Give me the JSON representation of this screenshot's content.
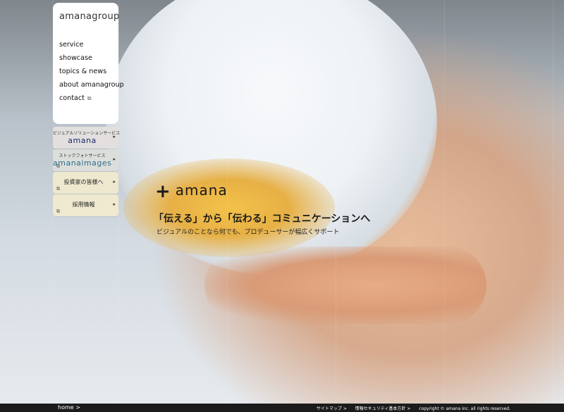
{
  "menu": {
    "logo": "amanagroup",
    "items": [
      {
        "label": "service",
        "external": false
      },
      {
        "label": "showcase",
        "external": false
      },
      {
        "label": "topics & news",
        "external": false
      },
      {
        "label": "about amanagroup",
        "external": false
      },
      {
        "label": "contact",
        "external": true,
        "ext_icon": "⧉"
      }
    ]
  },
  "subnav": {
    "amana": {
      "caption": "ビジュアルソリューションサービス",
      "brand": "amana",
      "arrow": "▸"
    },
    "images": {
      "caption": "ストックフォトサービス",
      "brand": "amanaimages",
      "arrow": "▸",
      "ext_icon": "⧉"
    },
    "investors": {
      "label": "投資家の皆様へ",
      "arrow": "▸",
      "ext_icon": "⧉"
    },
    "recruit": {
      "label": "採用情報",
      "arrow": "▸",
      "ext_icon": "⧉"
    }
  },
  "hero": {
    "mark_plus": "+",
    "mark_text": "amana",
    "tagline": "「伝える」から「伝わる」コミュニケーションへ",
    "subline": "ビジュアルのことなら何でも、プロデューサーが幅広くサポート"
  },
  "footer": {
    "home": "home >",
    "sitemap": "サイトマップ >",
    "security": "情報セキュリティ基本方針 >",
    "copyright": "copyright © amana inc. all rights reserved."
  },
  "colors": {
    "amana_brand": "#1d2b6b",
    "images_brand": "#2f6e8c",
    "footer_bg": "#1b1b1b"
  }
}
